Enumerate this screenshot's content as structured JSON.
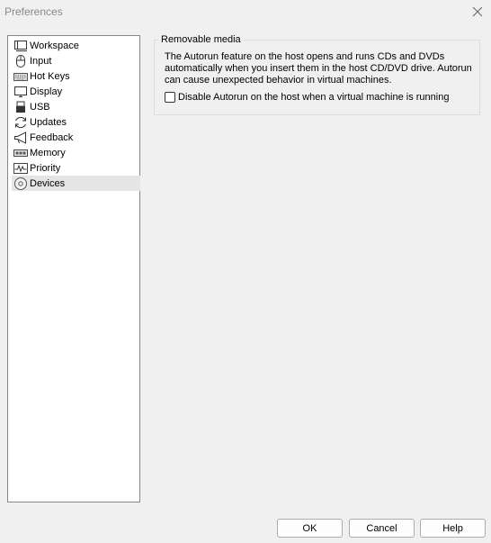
{
  "window": {
    "title": "Preferences"
  },
  "nav": {
    "items": [
      {
        "label": "Workspace",
        "icon": "workspace-icon"
      },
      {
        "label": "Input",
        "icon": "mouse-icon"
      },
      {
        "label": "Hot Keys",
        "icon": "keyboard-icon"
      },
      {
        "label": "Display",
        "icon": "monitor-icon"
      },
      {
        "label": "USB",
        "icon": "usb-icon"
      },
      {
        "label": "Updates",
        "icon": "refresh-icon"
      },
      {
        "label": "Feedback",
        "icon": "megaphone-icon"
      },
      {
        "label": "Memory",
        "icon": "memory-icon"
      },
      {
        "label": "Priority",
        "icon": "pulse-icon"
      },
      {
        "label": "Devices",
        "icon": "disc-icon"
      }
    ],
    "selected": "Devices"
  },
  "removable_media": {
    "group_title": "Removable media",
    "description": "The Autorun feature on the host opens and runs CDs and DVDs automatically when you insert them in the host CD/DVD drive. Autorun can cause unexpected behavior in virtual machines.",
    "checkbox_label": "Disable Autorun on the host when a virtual machine is running",
    "checked": false
  },
  "buttons": {
    "ok": "OK",
    "cancel": "Cancel",
    "help": "Help"
  }
}
